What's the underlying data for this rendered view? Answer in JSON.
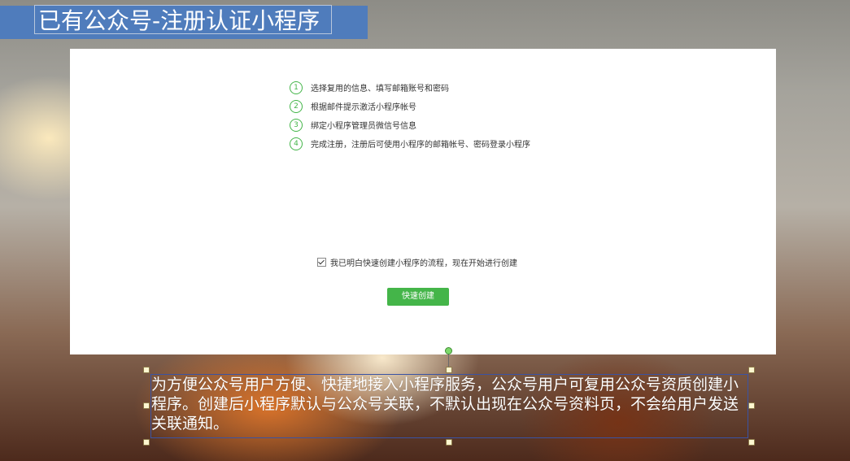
{
  "slide": {
    "title": "已有公众号-注册认证小程序"
  },
  "panel": {
    "steps": [
      {
        "num": "1",
        "text": "选择复用的信息、填写邮箱账号和密码"
      },
      {
        "num": "2",
        "text": "根据邮件提示激活小程序帐号"
      },
      {
        "num": "3",
        "text": "绑定小程序管理员微信号信息"
      },
      {
        "num": "4",
        "text": "完成注册，注册后可使用小程序的邮箱帐号、密码登录小程序"
      }
    ],
    "agree_label": "我已明白快速创建小程序的流程，现在开始进行创建",
    "agree_checked": true,
    "create_button_label": "快速创建"
  },
  "caption": {
    "text": "为方便公众号用户方便、快捷地接入小程序服务，公众号用户可复用公众号资质创建小程序。创建后小程序默认与公众号关联，不默认出现在公众号资料页，不会给用户发送关联通知。"
  },
  "colors": {
    "title_bar": "#4f7cbc",
    "accent_green": "#44b549",
    "selection_border": "#3a53a4"
  },
  "icons": {
    "checkbox": "check-icon",
    "rotate_handle": "rotate-handle-icon"
  }
}
